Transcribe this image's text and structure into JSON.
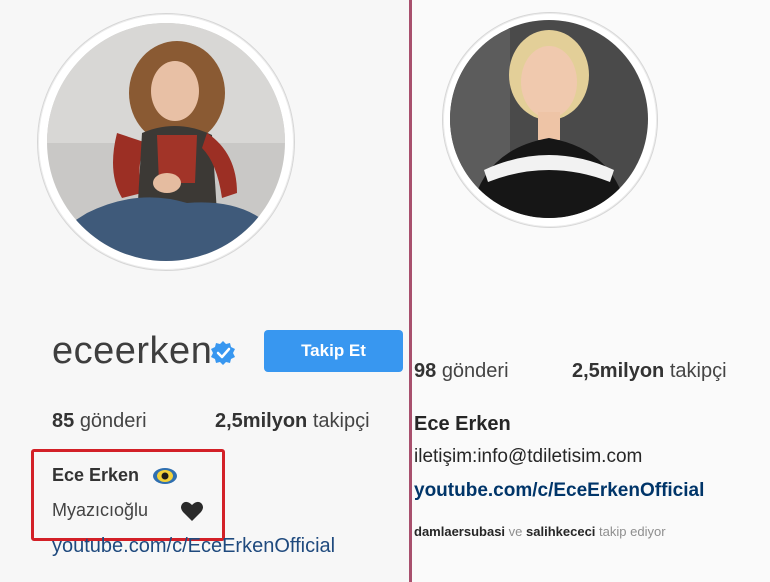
{
  "left": {
    "username": "eceerken",
    "follow_button": "Takip Et",
    "posts_count": "85",
    "posts_label": "gönderi",
    "followers_count": "2,5milyon",
    "followers_label": "takipçi",
    "bio_name": "Ece Erken",
    "bio_line": "Myazıcıoğlu",
    "link": "youtube.com/c/EceErkenOfficial",
    "icons": [
      "verified-badge-icon",
      "eye-emoji-icon",
      "black-heart-icon"
    ],
    "colors": {
      "button": "#3897f0",
      "highlight": "#d32027",
      "link": "#1f4a7e"
    }
  },
  "right": {
    "posts_count": "98",
    "posts_label": "gönderi",
    "followers_count": "2,5milyon",
    "followers_label": "takipçi",
    "bio_name": "Ece Erken",
    "contact": "iletişim:info@tdiletisim.com",
    "link": "youtube.com/c/EceErkenOfficial",
    "followed_by_user1": "damlaersubasi",
    "followed_by_and": "ve",
    "followed_by_user2": "salihkececi",
    "followed_by_suffix": "takip ediyor",
    "colors": {
      "link": "#003569"
    }
  },
  "divider_color": "#a8506d"
}
